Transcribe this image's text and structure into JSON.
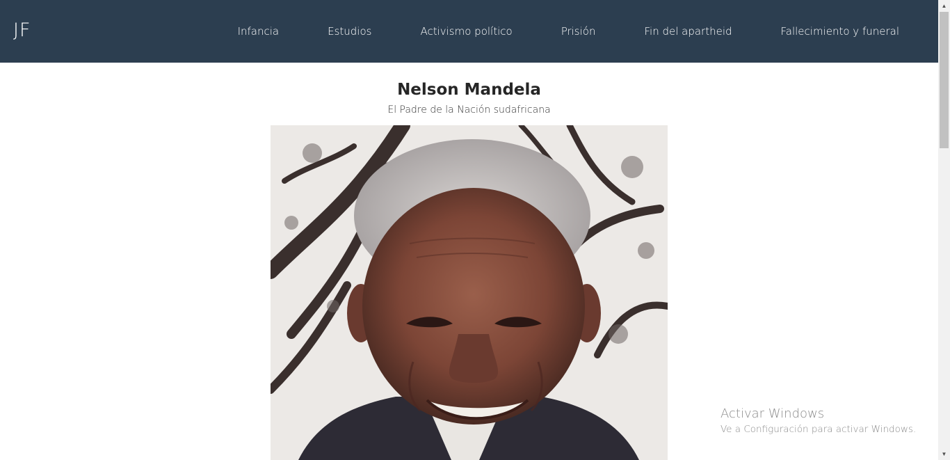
{
  "navbar": {
    "brand": "JF",
    "links": [
      {
        "label": "Infancia"
      },
      {
        "label": "Estudios"
      },
      {
        "label": "Activismo político"
      },
      {
        "label": "Prisión"
      },
      {
        "label": "Fin del apartheid"
      },
      {
        "label": "Fallecimiento y funeral"
      }
    ]
  },
  "header": {
    "title": "Nelson Mandela",
    "subtitle": "El Padre de la Nación sudafricana"
  },
  "watermark": {
    "title": "Activar Windows",
    "subtitle": "Ve a Configuración para activar Windows."
  },
  "colors": {
    "navbar_bg": "#2c3e50",
    "nav_text": "#ffffff"
  },
  "scrollbar": {
    "up_icon": "triangle-up-icon",
    "down_icon": "triangle-down-icon"
  }
}
